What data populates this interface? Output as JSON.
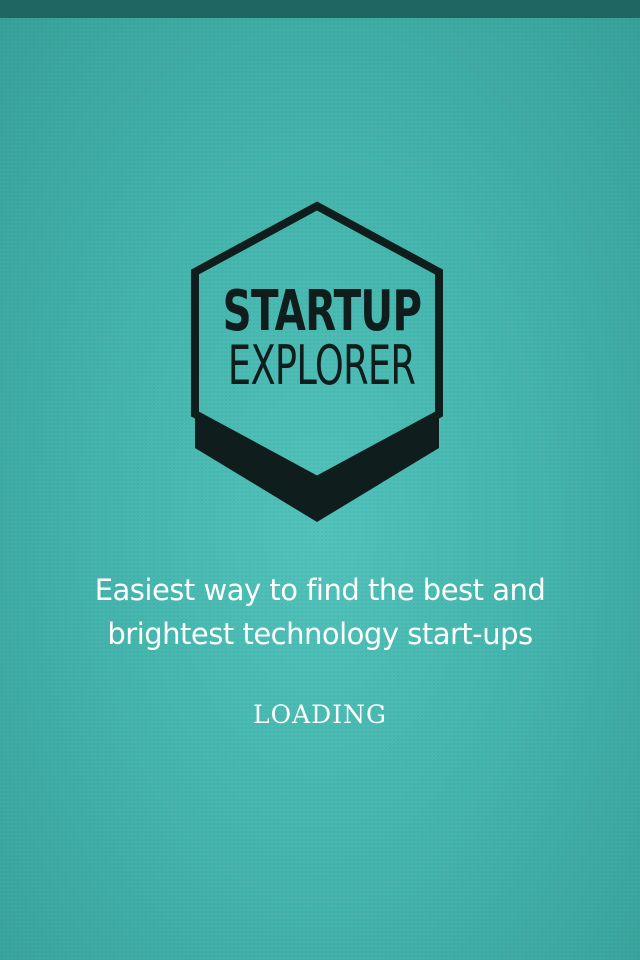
{
  "app": {
    "logo": {
      "line1": "STARTUP",
      "line2": "EXPLORER"
    },
    "tagline": {
      "line1": "Easiest way to find the best and",
      "line2": "brightest technology start-ups"
    },
    "status": "LOADING"
  },
  "colors": {
    "background": "#45b6ae",
    "status_bar": "#1f6662",
    "logo_dark": "#0f1e1d",
    "text": "#ffffff"
  }
}
